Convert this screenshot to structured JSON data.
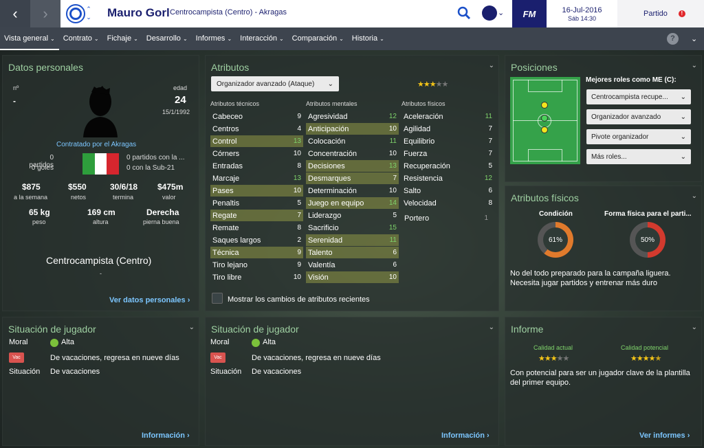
{
  "header": {
    "player_name": "Mauro Gorl",
    "player_sub": "Centrocampista (Centro) - Akragas",
    "date": "16-Jul-2016",
    "time": "Sáb 14:30",
    "logo": "FM",
    "match_button": "Partido"
  },
  "tabs": [
    {
      "label": "Vista general"
    },
    {
      "label": "Contrato"
    },
    {
      "label": "Fichaje"
    },
    {
      "label": "Desarrollo"
    },
    {
      "label": "Informes"
    },
    {
      "label": "Interacción"
    },
    {
      "label": "Comparación"
    },
    {
      "label": "Historia"
    }
  ],
  "personal": {
    "title": "Datos personales",
    "n_label": "nº",
    "n_value": "-",
    "age_label": "edad",
    "age_value": "24",
    "dob": "15/1/1992",
    "contract_text": "Contratado por el Akragas",
    "left_stats": [
      "0 partidos",
      "0 goles"
    ],
    "right_stats": [
      "0 partidos con la ...",
      "0 con la Sub-21"
    ],
    "money": [
      {
        "v": "$875",
        "l": "a la semana"
      },
      {
        "v": "$550",
        "l": "netos"
      },
      {
        "v": "30/6/18",
        "l": "termina"
      },
      {
        "v": "$475m",
        "l": "valor"
      }
    ],
    "physical": [
      {
        "v": "65 kg",
        "l": "peso"
      },
      {
        "v": "169 cm",
        "l": "altura"
      },
      {
        "v": "Derecha",
        "l": "pierna buena"
      }
    ],
    "position": "Centrocampista (Centro)",
    "position_sub": "-",
    "link": "Ver datos personales"
  },
  "attributes": {
    "title": "Atributos",
    "role": "Organizador avanzado (Ataque)",
    "role_stars": 3,
    "tech_head": "Atributos técnicos",
    "mental_head": "Atributos mentales",
    "phys_head": "Atributos físicos",
    "technical": [
      {
        "n": "Cabeceo",
        "v": "9"
      },
      {
        "n": "Centros",
        "v": "4"
      },
      {
        "n": "Control",
        "v": "13",
        "h": true
      },
      {
        "n": "Córners",
        "v": "10"
      },
      {
        "n": "Entradas",
        "v": "8"
      },
      {
        "n": "Marcaje",
        "v": "13"
      },
      {
        "n": "Pases",
        "v": "10",
        "h": true
      },
      {
        "n": "Penaltis",
        "v": "5"
      },
      {
        "n": "Regate",
        "v": "7",
        "h": true
      },
      {
        "n": "Remate",
        "v": "8"
      },
      {
        "n": "Saques largos",
        "v": "2"
      },
      {
        "n": "Técnica",
        "v": "9",
        "h": true
      },
      {
        "n": "Tiro lejano",
        "v": "9"
      },
      {
        "n": "Tiro libre",
        "v": "10"
      }
    ],
    "mental": [
      {
        "n": "Agresividad",
        "v": "12"
      },
      {
        "n": "Anticipación",
        "v": "10",
        "h": true
      },
      {
        "n": "Colocación",
        "v": "11"
      },
      {
        "n": "Concentración",
        "v": "10"
      },
      {
        "n": "Decisiones",
        "v": "13",
        "h": true
      },
      {
        "n": "Desmarques",
        "v": "7",
        "h": true
      },
      {
        "n": "Determinación",
        "v": "10"
      },
      {
        "n": "Juego en equipo",
        "v": "14",
        "h": true
      },
      {
        "n": "Liderazgo",
        "v": "5"
      },
      {
        "n": "Sacrificio",
        "v": "15"
      },
      {
        "n": "Serenidad",
        "v": "11",
        "h": true
      },
      {
        "n": "Talento",
        "v": "6",
        "h": true
      },
      {
        "n": "Valentía",
        "v": "6"
      },
      {
        "n": "Visión",
        "v": "10",
        "h": true
      }
    ],
    "physical": [
      {
        "n": "Aceleración",
        "v": "11"
      },
      {
        "n": "Agilidad",
        "v": "7"
      },
      {
        "n": "Equilibrio",
        "v": "7"
      },
      {
        "n": "Fuerza",
        "v": "7"
      },
      {
        "n": "Recuperación",
        "v": "5"
      },
      {
        "n": "Resistencia",
        "v": "12"
      },
      {
        "n": "Salto",
        "v": "6"
      },
      {
        "n": "Velocidad",
        "v": "8"
      }
    ],
    "goalkeeper": {
      "n": "Portero",
      "v": "1"
    },
    "show_changes": "Mostrar los cambios de atributos recientes"
  },
  "positions": {
    "title": "Posiciones",
    "best_roles_label": "Mejores roles como ME (C):",
    "roles": [
      "Centrocampista recupe...",
      "Organizador avanzado",
      "Pivote organizador",
      "Más roles..."
    ]
  },
  "fitness": {
    "title": "Atributos físicos",
    "condition_label": "Condición",
    "condition_value": "61%",
    "condition_pct": 61,
    "match_fitness_label": "Forma física para el parti...",
    "match_fitness_value": "50%",
    "match_fitness_pct": 50,
    "note": "No del todo preparado para la campaña liguera. Necesita jugar partidos y entrenar más duro"
  },
  "situation1": {
    "title": "Situación de jugador",
    "morale_label": "Moral",
    "morale_value": "Alta",
    "vac_badge": "Vac",
    "vac_text": "De vacaciones, regresa en nueve días",
    "situation_label": "Situación",
    "situation_value": "De vacaciones",
    "link": "Información"
  },
  "situation2": {
    "title": "Situación de jugador",
    "morale_label": "Moral",
    "morale_value": "Alta",
    "vac_badge": "Vac",
    "vac_text": "De vacaciones, regresa en nueve días",
    "situation_label": "Situación",
    "situation_value": "De vacaciones",
    "link": "Información"
  },
  "report": {
    "title": "Informe",
    "current_label": "Calidad actual",
    "current_stars": 3,
    "potential_label": "Calidad potencial",
    "potential_stars": 4.5,
    "text": "Con potencial para ser un jugador clave de la plantilla del primer equipo.",
    "link": "Ver informes"
  },
  "colors": {
    "accent": "#9fd0a2",
    "link": "#7cc6ff",
    "highlight": "#8f9846",
    "condition": "#e07a2c",
    "match_fitness": "#d23a2e"
  }
}
